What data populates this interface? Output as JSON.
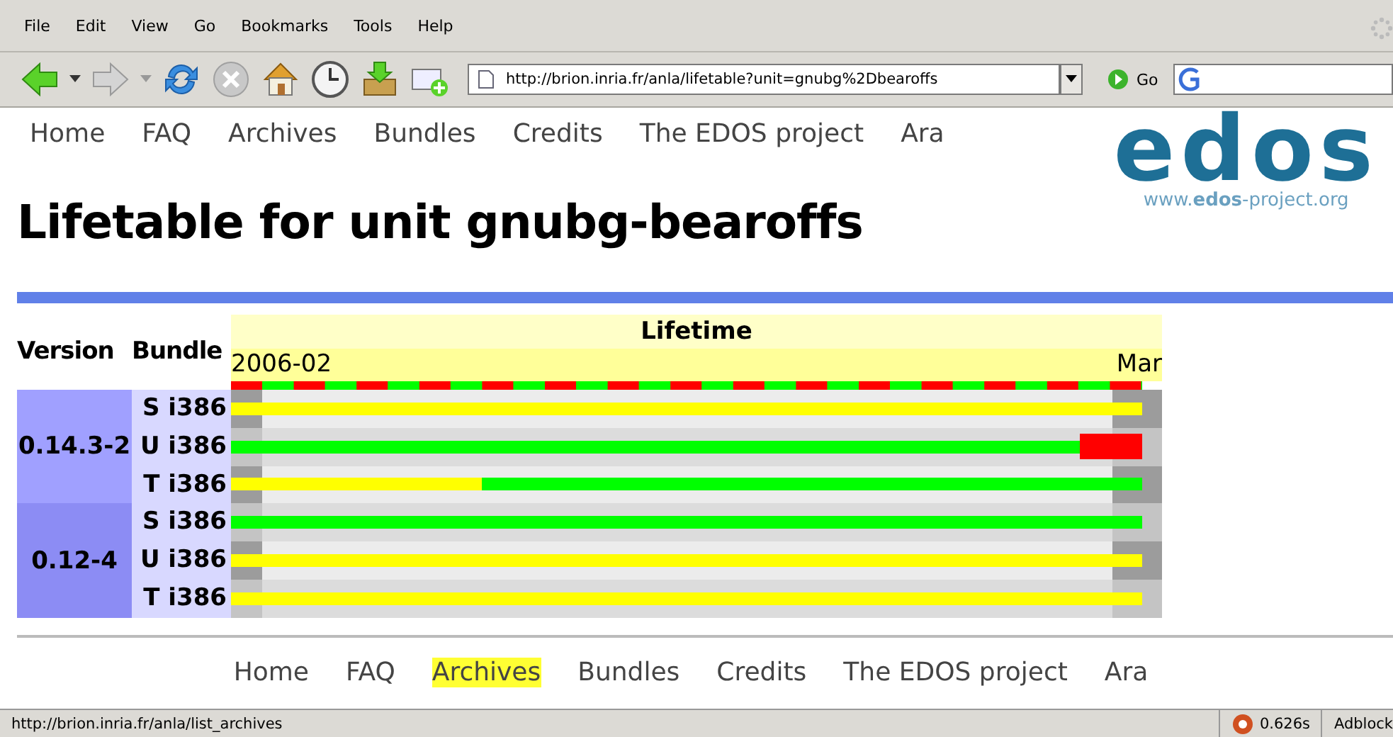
{
  "menu": [
    {
      "label": "File"
    },
    {
      "label": "Edit"
    },
    {
      "label": "View"
    },
    {
      "label": "Go"
    },
    {
      "label": "Bookmarks"
    },
    {
      "label": "Tools"
    },
    {
      "label": "Help"
    }
  ],
  "address": {
    "value": "http://brion.inria.fr/anla/lifetable?unit=gnubg%2Dbearoffs",
    "go": "Go"
  },
  "nav": [
    {
      "label": "Home"
    },
    {
      "label": "FAQ"
    },
    {
      "label": "Archives"
    },
    {
      "label": "Bundles"
    },
    {
      "label": "Credits"
    },
    {
      "label": "The EDOS project"
    },
    {
      "label": "Ara"
    }
  ],
  "logo": {
    "mark": "edos",
    "url": "www.**edos**-project.org"
  },
  "title": "Lifetable for unit gnubg-bearoffs",
  "table": {
    "columns": [
      "Version",
      "Bundle"
    ],
    "lifetime": "Lifetime",
    "start": "2006-02",
    "end": "Mar",
    "groups": [
      {
        "version": "0.14.3-2",
        "rows": [
          {
            "bundle": "S i386",
            "segments": [
              {
                "kind": "bar",
                "color": "#ffff00",
                "level": 1
              }
            ]
          },
          {
            "bundle": "U i386",
            "segments": [
              {
                "kind": "bar",
                "color": "#00ff00",
                "level": 0.932
              },
              {
                "kind": "block",
                "color": "#ff0000"
              }
            ]
          },
          {
            "bundle": "T i386",
            "segments": [
              {
                "kind": "bar",
                "color": "#ffff00",
                "level": 0.275
              },
              {
                "kind": "bar",
                "color": "#00ff00"
              }
            ]
          }
        ]
      },
      {
        "version": "0.12-4",
        "rows": [
          {
            "bundle": "S i386",
            "segments": [
              {
                "kind": "bar",
                "color": "#00ff00",
                "level": 1
              }
            ]
          },
          {
            "bundle": "U i386",
            "segments": [
              {
                "kind": "bar",
                "color": "#ffff00",
                "level": 1
              }
            ]
          },
          {
            "bundle": "T i386",
            "segments": [
              {
                "kind": "bar",
                "color": "#ffff00",
                "level": 1
              }
            ]
          }
        ]
      }
    ]
  },
  "footer_nav": [
    {
      "label": "Home",
      "selected": false
    },
    {
      "label": "FAQ",
      "selected": false
    },
    {
      "label": "Archives",
      "selected": true
    },
    {
      "label": "Bundles",
      "selected": false
    },
    {
      "label": "Credits",
      "selected": false
    },
    {
      "label": "The EDOS project",
      "selected": false
    },
    {
      "label": "Ara",
      "selected": false
    }
  ],
  "status": {
    "text": "http://brion.inria.fr/anla/list_archives",
    "timing": "0.626s",
    "adblock": "Adblock"
  }
}
